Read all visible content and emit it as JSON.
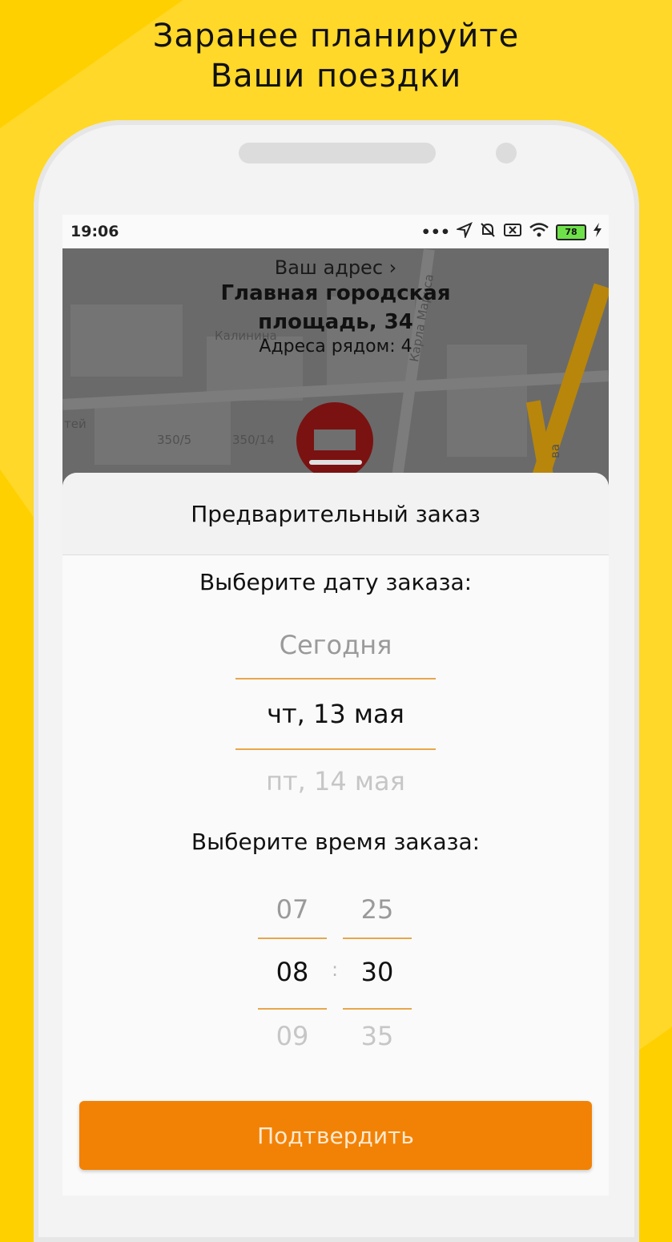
{
  "promo": {
    "headline_line1": "Заранее планируйте",
    "headline_line2": "Ваши поездки"
  },
  "status_bar": {
    "time": "19:06",
    "battery": "78",
    "icons": [
      "dots-icon",
      "location-arrow-icon",
      "bell-off-icon",
      "sim-off-icon",
      "wifi-icon",
      "battery-icon",
      "charging-icon"
    ]
  },
  "map": {
    "address_link": "Ваш адрес ›",
    "address_main_line1": "Главная городская",
    "address_main_line2": "площадь, 34",
    "addresses_nearby": "Адреса рядом: 4",
    "street_labels": [
      "Калинина",
      "Карла Маркса",
      "тей",
      "350/5",
      "350/14",
      "ва"
    ]
  },
  "sheet": {
    "title": "Предварительный заказ",
    "date_label": "Выберите дату заказа:",
    "dates": [
      "Сегодня",
      "чт, 13 мая",
      "пт, 14 мая"
    ],
    "selected_date": "чт, 13 мая",
    "time_label": "Выберите время заказа:",
    "hours": [
      "07",
      "08",
      "09"
    ],
    "minutes": [
      "25",
      "30",
      "35"
    ],
    "selected_hour": "08",
    "selected_minute": "30",
    "time_separator": ":",
    "confirm_button": "Подтвердить"
  },
  "colors": {
    "background": "#ffd000",
    "accent": "#f28205",
    "picker_line": "#e8a64a"
  }
}
